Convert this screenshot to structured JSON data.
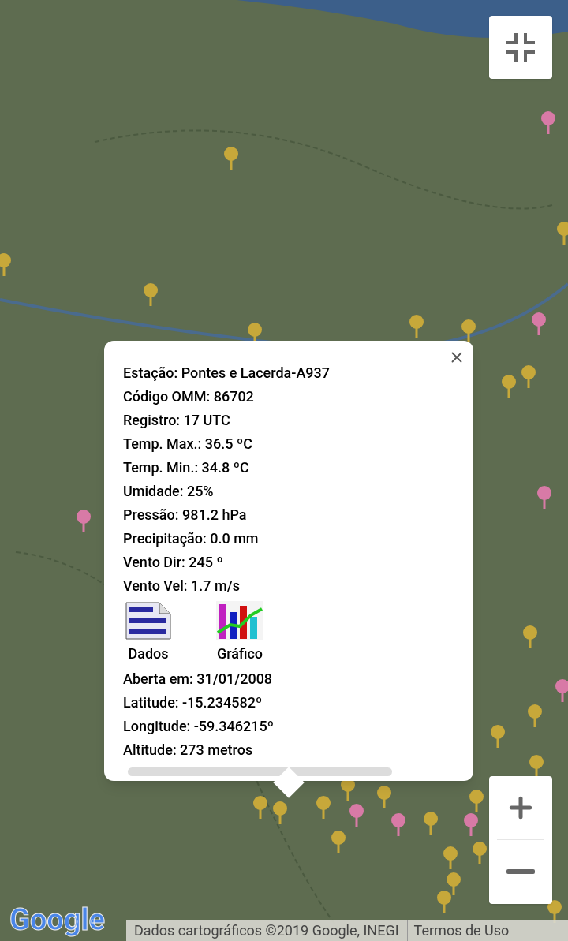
{
  "info_window": {
    "lines": [
      "Estação: Pontes e Lacerda-A937",
      "Código OMM: 86702",
      "Registro: 17 UTC",
      "Temp. Max.: 36.5 ºC",
      "Temp. Min.: 34.8 ºC",
      "Umidade: 25%",
      "Pressão: 981.2 hPa",
      "Precipitação: 0.0 mm",
      "Vento Dir: 245 º",
      "Vento Vel: 1.7 m/s"
    ],
    "links": [
      {
        "kind": "data",
        "label": "Dados"
      },
      {
        "kind": "chart",
        "label": "Gráfico"
      }
    ],
    "details": [
      "Aberta em: 31/01/2008",
      "Latitude: -15.234582º",
      "Longitude: -59.346215º",
      "Altitude: 273 metros"
    ]
  },
  "logo": "Google",
  "attribution": "Dados cartográficos ©2019 Google, INEGI",
  "terms_link": "Termos de Uso"
}
